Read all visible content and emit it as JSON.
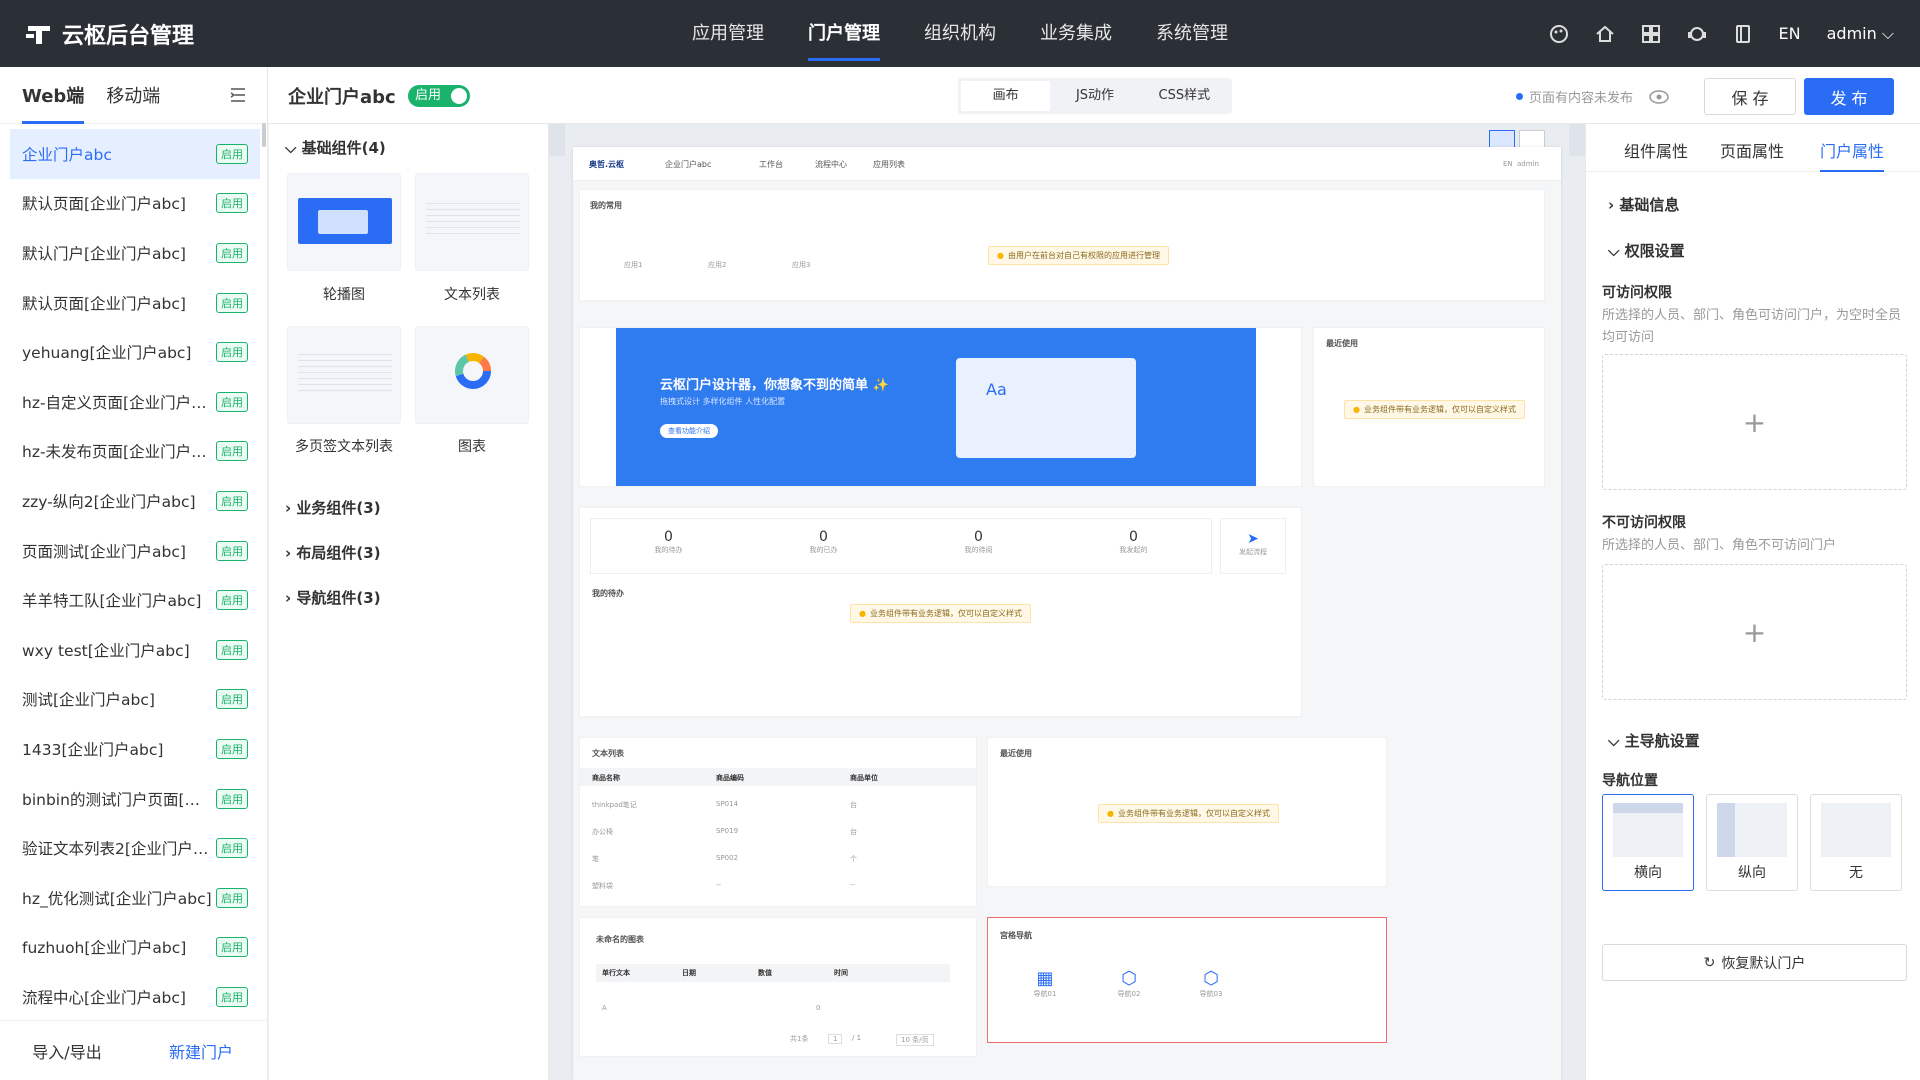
{
  "app": {
    "title": "云枢后台管理"
  },
  "topnav": {
    "items": [
      "应用管理",
      "门户管理",
      "组织机构",
      "业务集成",
      "系统管理"
    ],
    "active": "门户管理",
    "lang": "EN",
    "user": "admin"
  },
  "left": {
    "tabs": [
      "Web端",
      "移动端"
    ],
    "pages": [
      {
        "name": "企业门户abc",
        "status": "启用"
      },
      {
        "name": "默认页面[企业门户abc]",
        "status": "启用"
      },
      {
        "name": "默认门户[企业门户abc]",
        "status": "启用"
      },
      {
        "name": "默认页面[企业门户abc]",
        "status": "启用"
      },
      {
        "name": "yehuang[企业门户abc]",
        "status": "启用"
      },
      {
        "name": "hz-自定义页面[企业门户ab...",
        "status": "启用"
      },
      {
        "name": "hz-未发布页面[企业门户ab...",
        "status": "启用"
      },
      {
        "name": "zzy-纵向2[企业门户abc]",
        "status": "启用"
      },
      {
        "name": "页面测试[企业门户abc]",
        "status": "启用"
      },
      {
        "name": "羊羊特工队[企业门户abc]",
        "status": "启用"
      },
      {
        "name": "wxy test[企业门户abc]",
        "status": "启用"
      },
      {
        "name": "测试[企业门户abc]",
        "status": "启用"
      },
      {
        "name": "1433[企业门户abc]",
        "status": "启用"
      },
      {
        "name": "binbin的测试门户页面[企...",
        "status": "启用"
      },
      {
        "name": "验证文本列表2[企业门户a...",
        "status": "启用"
      },
      {
        "name": "hz_优化测试[企业门户abc]",
        "status": "启用"
      },
      {
        "name": "fuzhuoh[企业门户abc]",
        "status": "启用"
      },
      {
        "name": "流程中心[企业门户abc]",
        "status": "启用"
      }
    ],
    "footer": {
      "import_export": "导入/导出",
      "new_portal": "新建门户"
    }
  },
  "subbar": {
    "portal_name": "企业门户abc",
    "toggle_label": "启用",
    "modes": [
      "画布",
      "JS动作",
      "CSS样式"
    ],
    "active_mode": "画布",
    "unpublished_note": "页面有内容未发布",
    "save": "保 存",
    "publish": "发 布"
  },
  "components": {
    "basic_group": "基础组件(4)",
    "basic_items": [
      "轮播图",
      "文本列表",
      "多页签文本列表",
      "图表"
    ],
    "groups": [
      "业务组件(3)",
      "布局组件(3)",
      "导航组件(3)"
    ]
  },
  "canvas": {
    "header": {
      "logo": "奥哲.云枢",
      "portal": "企业门户abc",
      "nav": [
        "工作台",
        "流程中心",
        "应用列表"
      ],
      "lang": "EN",
      "user": "admin"
    },
    "favorites": {
      "title": "我的常用",
      "items": [
        "应用1",
        "应用2",
        "应用3"
      ],
      "warn": "由用户在前台对自己有权限的应用进行管理"
    },
    "banner": {
      "title": "云枢门户设计器，你想象不到的简单 ✨",
      "subtitle": "拖拽式设计   多样化组件   人性化配置",
      "button": "查看功能介绍",
      "float_label": "Aa"
    },
    "recent1": {
      "title": "最近使用",
      "warn": "业务组件带有业务逻辑，仅可以自定义样式"
    },
    "stats": [
      {
        "value": "0",
        "label": "我的待办"
      },
      {
        "value": "0",
        "label": "我的已办"
      },
      {
        "value": "0",
        "label": "我的待阅"
      },
      {
        "value": "0",
        "label": "我发起的"
      }
    ],
    "start_flow": "发起流程",
    "todo": {
      "title": "我的待办",
      "warn": "业务组件带有业务逻辑，仅可以自定义样式"
    },
    "textlist": {
      "title": "文本列表",
      "columns": [
        "商品名称",
        "商品编码",
        "商品单位"
      ],
      "rows": [
        [
          "thinkpad笔记",
          "SP014",
          "台"
        ],
        [
          "办公椅",
          "SP019",
          "台"
        ],
        [
          "笔",
          "SP002",
          "个"
        ],
        [
          "塑料袋",
          "--",
          "--"
        ]
      ]
    },
    "recent2": {
      "title": "最近使用",
      "warn": "业务组件带有业务逻辑，仅可以自定义样式"
    },
    "chart": {
      "title": "未命名的图表",
      "columns": [
        "单行文本",
        "日期",
        "数值",
        "时间"
      ],
      "row": [
        "A",
        "",
        "0",
        ""
      ],
      "pager": {
        "total": "共1条",
        "page": "1",
        "pages": "/ 1",
        "size": "10 条/页"
      }
    },
    "gridnav": {
      "title": "宫格导航",
      "items": [
        "导航01",
        "导航02",
        "导航03"
      ]
    }
  },
  "right": {
    "tabs": [
      "组件属性",
      "页面属性",
      "门户属性"
    ],
    "active_tab": "门户属性",
    "basic_info": "基础信息",
    "perm_settings": "权限设置",
    "access_label": "可访问权限",
    "access_desc": "所选择的人员、部门、角色可访问门户，为空时全员均可访问",
    "deny_label": "不可访问权限",
    "deny_desc": "所选择的人员、部门、角色不可访问门户",
    "main_nav": "主导航设置",
    "nav_pos_label": "导航位置",
    "nav_positions": [
      "横向",
      "纵向",
      "无"
    ],
    "nav_selected": "横向",
    "restore": "恢复默认门户"
  },
  "colors": {
    "primary": "#2a6df4",
    "topbar": "#2b2f36",
    "success": "#1ab36b",
    "danger": "#f06b6b"
  }
}
